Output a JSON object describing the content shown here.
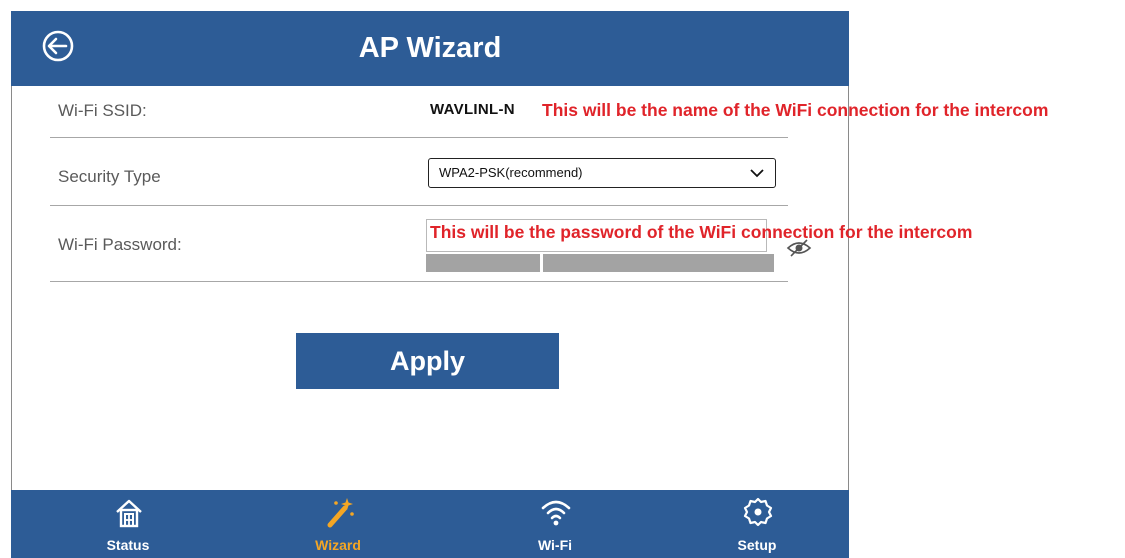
{
  "header": {
    "title": "AP Wizard",
    "back_icon": "back-arrow-icon"
  },
  "form": {
    "ssid_label": "Wi-Fi SSID:",
    "ssid_value": "WAVLINL-N",
    "security_label": "Security Type",
    "security_value": "WPA2-PSK(recommend)",
    "password_label": "Wi-Fi Password:",
    "password_value": "",
    "eye_icon": "eye-slash-icon"
  },
  "annotations": {
    "ssid_note": "This will be the name of the WiFi connection for the intercom",
    "password_note": "This will be the password of the WiFi connection for the intercom",
    "color": "#e0242a"
  },
  "apply_label": "Apply",
  "nav": {
    "items": [
      {
        "label": "Status",
        "icon": "home-icon",
        "active": false
      },
      {
        "label": "Wizard",
        "icon": "magic-wand-icon",
        "active": true
      },
      {
        "label": "Wi-Fi",
        "icon": "wifi-icon",
        "active": false
      },
      {
        "label": "Setup",
        "icon": "gear-icon",
        "active": false
      }
    ],
    "active_color": "#f4a624"
  },
  "colors": {
    "brand": "#2d5c96"
  }
}
